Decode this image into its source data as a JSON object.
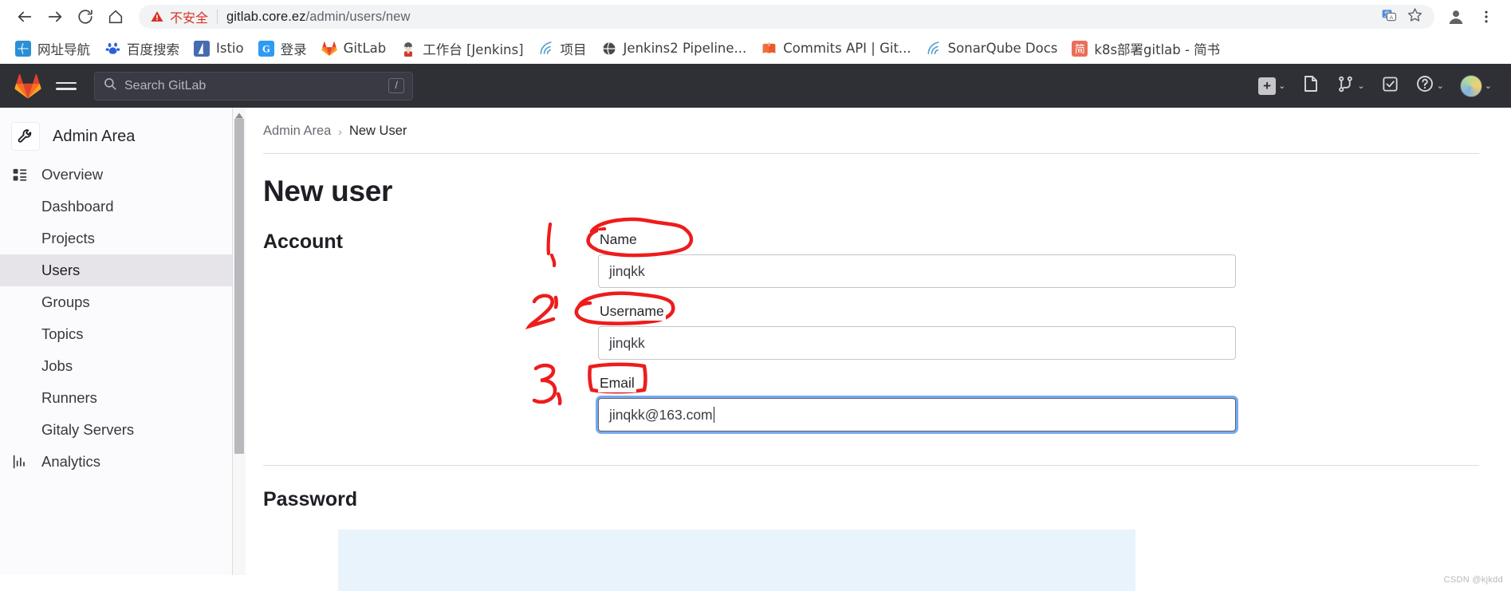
{
  "browser": {
    "nav": {
      "back": "back-arrow",
      "forward": "forward-arrow",
      "reload": "reload",
      "home": "home"
    },
    "omnibox": {
      "security_label": "不安全",
      "url_host": "gitlab.core.ez",
      "url_path": "/admin/users/new",
      "translate_icon": "translate-icon",
      "bookmark_icon": "star-icon"
    },
    "profile_icon": "profile-avatar-icon",
    "menu_icon": "three-dot-menu-icon",
    "bookmarks": [
      {
        "label": "网址导航",
        "icon": "globe-icon",
        "color": "#2b8fd6",
        "glyph": "🌐"
      },
      {
        "label": "百度搜索",
        "icon": "baidu-icon",
        "color": "#2b5fd9",
        "glyph": "熊"
      },
      {
        "label": "Istio",
        "icon": "istio-icon",
        "color": "#466bb0",
        "glyph": "▲"
      },
      {
        "label": "登录",
        "icon": "google-g-icon",
        "color": "#2f9bf3",
        "glyph": "G"
      },
      {
        "label": "GitLab",
        "icon": "gitlab-fox-icon",
        "color": "#fc6d26",
        "glyph": "🦊"
      },
      {
        "label": "工作台 [Jenkins]",
        "icon": "jenkins-icon",
        "color": "#d9d3cb",
        "glyph": "J"
      },
      {
        "label": "项目",
        "icon": "sonarqube-icon",
        "color": "#4e9bcd",
        "glyph": "》"
      },
      {
        "label": "Jenkins2 Pipeline...",
        "icon": "globe-dark-icon",
        "color": "#4a4a52",
        "glyph": "🌐"
      },
      {
        "label": "Commits API | Git...",
        "icon": "book-icon",
        "color": "#f26d3d",
        "glyph": "📕"
      },
      {
        "label": "SonarQube Docs",
        "icon": "sonarqube-icon",
        "color": "#4e9bcd",
        "glyph": "》"
      },
      {
        "label": "k8s部署gitlab - 简书",
        "icon": "jianshu-icon",
        "color": "#ea6f5a",
        "glyph": "简"
      }
    ]
  },
  "gitlab_navbar": {
    "logo": "gitlab-tanuki-logo",
    "menu_icon": "hamburger-menu-icon",
    "search": {
      "placeholder": "Search GitLab",
      "icon": "search-icon",
      "shortcut": "/"
    },
    "actions": [
      {
        "name": "create-new-dropdown",
        "icon": "plus-square-icon",
        "caret": "⌄"
      },
      {
        "name": "issues-link",
        "icon": "issues-icon",
        "caret": ""
      },
      {
        "name": "merge-requests-dropdown",
        "icon": "merge-request-icon",
        "caret": "⌄"
      },
      {
        "name": "todos-link",
        "icon": "todo-checkbox-icon",
        "caret": ""
      },
      {
        "name": "help-dropdown",
        "icon": "help-circle-icon",
        "caret": "⌄"
      },
      {
        "name": "user-menu",
        "icon": "user-avatar",
        "caret": "⌄"
      }
    ]
  },
  "sidebar": {
    "header": {
      "label": "Admin Area",
      "icon": "wrench-icon"
    },
    "groups": [
      {
        "label": "Overview",
        "icon": "overview-list-icon",
        "is_group": true
      },
      {
        "label": "Dashboard",
        "is_group": false,
        "active": false
      },
      {
        "label": "Projects",
        "is_group": false,
        "active": false
      },
      {
        "label": "Users",
        "is_group": false,
        "active": true
      },
      {
        "label": "Groups",
        "is_group": false,
        "active": false
      },
      {
        "label": "Topics",
        "is_group": false,
        "active": false
      },
      {
        "label": "Jobs",
        "is_group": false,
        "active": false
      },
      {
        "label": "Runners",
        "is_group": false,
        "active": false
      },
      {
        "label": "Gitaly Servers",
        "is_group": false,
        "active": false
      },
      {
        "label": "Analytics",
        "icon": "chart-bar-icon",
        "is_group": true
      }
    ]
  },
  "main": {
    "breadcrumb": {
      "root": "Admin Area",
      "separator": "›",
      "current": "New User"
    },
    "page_title": "New user",
    "sections": [
      {
        "label": "Account",
        "fields": [
          {
            "label": "Name",
            "value": "jinqkk",
            "focused": false
          },
          {
            "label": "Username",
            "value": "jinqkk",
            "focused": false
          },
          {
            "label": "Email",
            "value": "jinqkk@163.com",
            "focused": true
          }
        ]
      },
      {
        "label": "Password",
        "fields": []
      }
    ]
  },
  "annotations": [
    {
      "text": "1,",
      "target": "Name",
      "shape": "circle"
    },
    {
      "text": "2,",
      "target": "Username",
      "shape": "circle"
    },
    {
      "text": "3,",
      "target": "Email",
      "shape": "rectangle"
    }
  ],
  "watermark": "CSDN @kjkdd",
  "colors": {
    "annotation_red": "#ee1c1c",
    "gitlab_orange": "#fc6d26",
    "navbar_bg": "#2f2f36",
    "sidebar_bg": "#fbfafd",
    "active_item_bg": "#e6e4e9",
    "focus_blue": "#76aaee",
    "insecure_red": "#d93025"
  }
}
